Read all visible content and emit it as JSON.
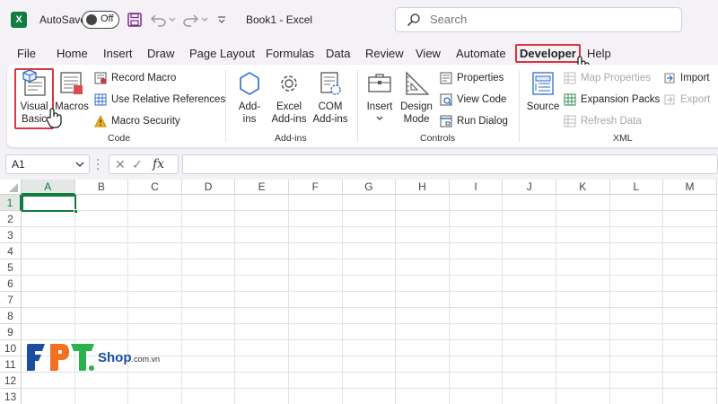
{
  "title_bar": {
    "app_icon_letter": "X",
    "autosave_label": "AutoSave",
    "autosave_state": "Off",
    "document_title": "Book1 - Excel",
    "search_placeholder": "Search"
  },
  "menu_tabs": [
    "File",
    "Home",
    "Insert",
    "Draw",
    "Page Layout",
    "Formulas",
    "Data",
    "Review",
    "View",
    "Automate",
    "Developer",
    "Help"
  ],
  "active_tab": "Developer",
  "ribbon": {
    "code": {
      "label": "Code",
      "visual_basic": "Visual Basic",
      "macros": "Macros",
      "record_macro": "Record Macro",
      "use_relative_references": "Use Relative References",
      "macro_security": "Macro Security"
    },
    "addins": {
      "label": "Add-ins",
      "add_ins": "Add-ins",
      "excel_add_ins": "Excel Add-ins",
      "com_add_ins": "COM Add-ins"
    },
    "controls": {
      "label": "Controls",
      "insert": "Insert",
      "design_mode": "Design Mode",
      "properties": "Properties",
      "view_code": "View Code",
      "run_dialog": "Run Dialog"
    },
    "xml": {
      "label": "XML",
      "source": "Source",
      "map_properties": "Map Properties",
      "expansion_packs": "Expansion Packs",
      "refresh_data": "Refresh Data",
      "import": "Import",
      "export": "Export"
    }
  },
  "formula_bar": {
    "name_box": "A1",
    "fx_label": "fx",
    "cancel_glyph": "✕",
    "enter_glyph": "✓",
    "content": ""
  },
  "sheet": {
    "columns": [
      "A",
      "B",
      "C",
      "D",
      "E",
      "F",
      "G",
      "H",
      "I",
      "J",
      "K",
      "L",
      "M"
    ],
    "rows": [
      "1",
      "2",
      "3",
      "4",
      "5",
      "6",
      "7",
      "8",
      "9",
      "10",
      "11",
      "12",
      "13"
    ],
    "active_cell": "A1"
  },
  "watermark": {
    "letters": [
      "F",
      "P",
      "T"
    ],
    "shop": "Shop",
    "domain": ".com.vn"
  },
  "colors": {
    "excel_green": "#107c41",
    "highlight_red": "#d9363e",
    "fpt_blue": "#1b4ea1",
    "fpt_orange": "#f37021",
    "fpt_green": "#2bb24c"
  }
}
